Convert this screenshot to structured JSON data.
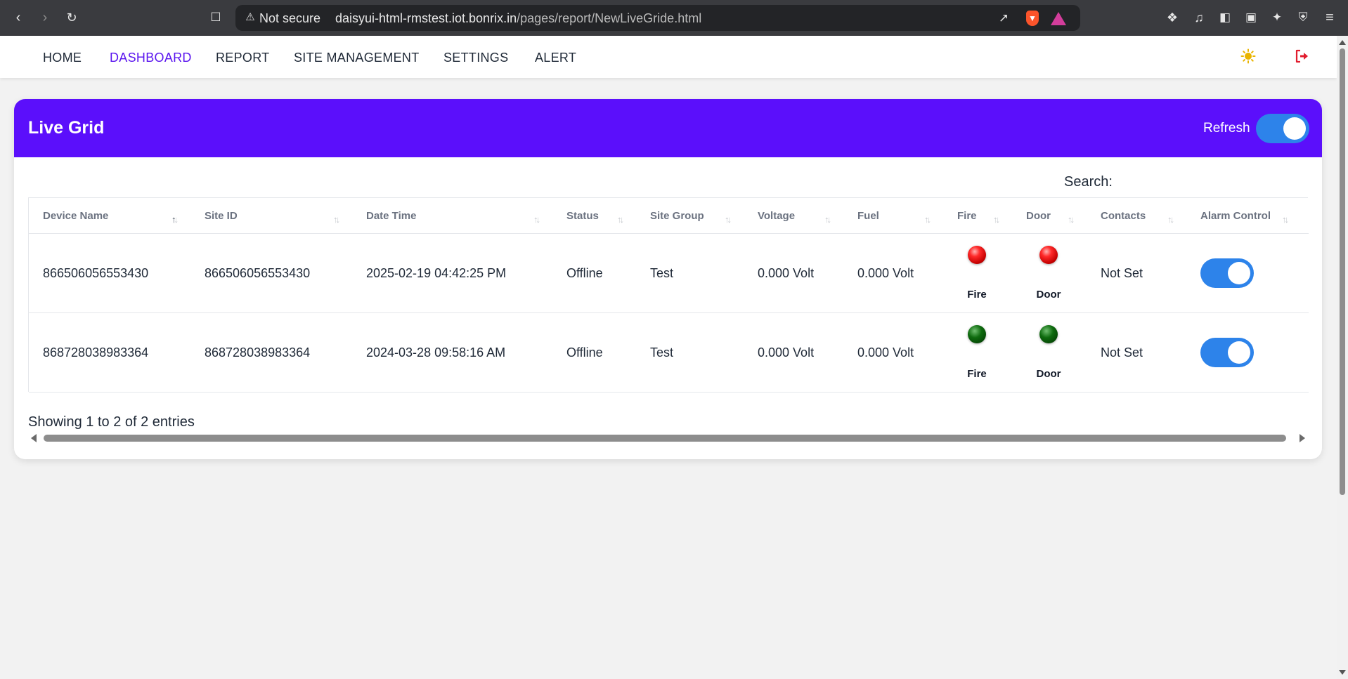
{
  "browser": {
    "insecure_label": "Not secure",
    "url_host": "daisyui-html-rmstest.iot.bonrix.in",
    "url_path": "/pages/report/NewLiveGride.html",
    "icons": [
      "back-icon",
      "forward-icon",
      "reload-icon",
      "bookmark-icon",
      "warning-icon",
      "share-icon",
      "brave-shields-icon",
      "brave-rewards-icon",
      "extensions-icon",
      "music-icon",
      "sidebar-icon",
      "wallet-icon",
      "leo-icon",
      "vpn-icon",
      "menu-icon"
    ]
  },
  "nav": {
    "items": [
      {
        "label": "HOME",
        "active": false
      },
      {
        "label": "DASHBOARD",
        "active": true
      },
      {
        "label": "REPORT",
        "active": false
      },
      {
        "label": "SITE MANAGEMENT",
        "active": false
      },
      {
        "label": "SETTINGS",
        "active": false
      },
      {
        "label": "ALERT",
        "active": false
      }
    ],
    "theme_icon": "sun-icon",
    "logout_icon": "logout-icon",
    "accent_color": "#5b16ef"
  },
  "card": {
    "title": "Live Grid",
    "refresh_label": "Refresh",
    "refresh_on": true,
    "header_color": "#5b0ffb"
  },
  "search": {
    "label": "Search:"
  },
  "table": {
    "columns": [
      "Device Name",
      "Site ID",
      "Date Time",
      "Status",
      "Site Group",
      "Voltage",
      "Fuel",
      "Fire",
      "Door",
      "Contacts",
      "Alarm Control"
    ],
    "sorted_column": "Device Name",
    "rows": [
      {
        "device_name": "866506056553430",
        "site_id": "866506056553430",
        "date_time": "2025-02-19 04:42:25 PM",
        "status": "Offline",
        "site_group": "Test",
        "voltage": "0.000 Volt",
        "fuel": "0.000 Volt",
        "fire_label": "Fire",
        "fire_state": "red",
        "door_label": "Door",
        "door_state": "red",
        "contacts": "Not Set",
        "alarm_on": true
      },
      {
        "device_name": "868728038983364",
        "site_id": "868728038983364",
        "date_time": "2024-03-28 09:58:16 AM",
        "status": "Offline",
        "site_group": "Test",
        "voltage": "0.000 Volt",
        "fuel": "0.000 Volt",
        "fire_label": "Fire",
        "fire_state": "green",
        "door_label": "Door",
        "door_state": "green",
        "contacts": "Not Set",
        "alarm_on": true
      }
    ]
  },
  "footer": {
    "showing": "Showing 1 to 2 of 2 entries"
  },
  "colors": {
    "toggle_on": "#2d83ea",
    "led_red": "#ff2a2a",
    "led_green": "#0e6b0e"
  }
}
